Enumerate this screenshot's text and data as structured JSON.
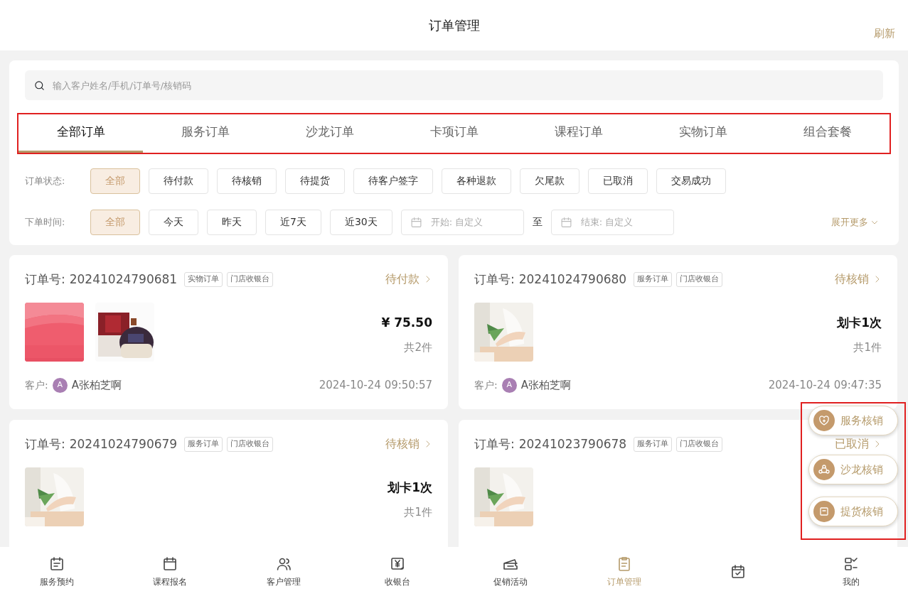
{
  "header": {
    "title": "订单管理",
    "action": "刷新"
  },
  "search": {
    "placeholder": "输入客户姓名/手机/订单号/核销码"
  },
  "tabs_highlighted": true,
  "tabs": [
    {
      "label": "全部订单",
      "selected": true
    },
    {
      "label": "服务订单",
      "selected": false
    },
    {
      "label": "沙龙订单",
      "selected": false
    },
    {
      "label": "卡项订单",
      "selected": false
    },
    {
      "label": "课程订单",
      "selected": false
    },
    {
      "label": "实物订单",
      "selected": false
    },
    {
      "label": "组合套餐",
      "selected": false
    }
  ],
  "status_filter": {
    "label": "订单状态:",
    "options": [
      {
        "label": "全部",
        "selected": true
      },
      {
        "label": "待付款",
        "selected": false
      },
      {
        "label": "待核销",
        "selected": false
      },
      {
        "label": "待提货",
        "selected": false
      },
      {
        "label": "待客户签字",
        "selected": false
      },
      {
        "label": "各种退款",
        "selected": false
      },
      {
        "label": "欠尾款",
        "selected": false
      },
      {
        "label": "已取消",
        "selected": false
      },
      {
        "label": "交易成功",
        "selected": false
      }
    ]
  },
  "time_filter": {
    "label": "下单时间:",
    "options": [
      {
        "label": "全部",
        "selected": true
      },
      {
        "label": "今天",
        "selected": false
      },
      {
        "label": "昨天",
        "selected": false
      },
      {
        "label": "近7天",
        "selected": false
      },
      {
        "label": "近30天",
        "selected": false
      }
    ],
    "start_placeholder": "开始: 自定义",
    "separator": "至",
    "end_placeholder": "结束: 自定义",
    "more": "展开更多"
  },
  "orders": [
    {
      "number_label": "订单号:",
      "number": "20241024790681",
      "tags": [
        "实物订单",
        "门店收银台"
      ],
      "status": "待付款",
      "images": [
        {
          "kind": "picture"
        },
        {
          "kind": "picture"
        }
      ],
      "amount": "¥ 75.50",
      "count": "共2件",
      "customer_label": "客户:",
      "avatar": "A",
      "customer": "A张柏芝啊",
      "time": "2024-10-24 09:50:57"
    },
    {
      "number_label": "订单号:",
      "number": "20241024790680",
      "tags": [
        "服务订单",
        "门店收银台"
      ],
      "status": "待核销",
      "images": [
        {
          "kind": "picture"
        }
      ],
      "amount": "划卡1次",
      "count": "共1件",
      "customer_label": "客户:",
      "avatar": "A",
      "customer": "A张柏芝啊",
      "time": "2024-10-24 09:47:35"
    },
    {
      "number_label": "订单号:",
      "number": "20241024790679",
      "tags": [
        "服务订单",
        "门店收银台"
      ],
      "status": "待核销",
      "images": [
        {
          "kind": "picture"
        }
      ],
      "amount": "划卡1次",
      "count": "共1件"
    },
    {
      "number_label": "订单号:",
      "number": "20241023790678",
      "tags": [
        "服务订单",
        "门店收银台"
      ],
      "status": "已取消",
      "images": [
        {
          "kind": "picture"
        }
      ]
    }
  ],
  "floating_actions_highlighted": true,
  "floating_actions": [
    {
      "label": "服务核销",
      "kind": "heart"
    },
    {
      "label": "沙龙核销",
      "kind": "people"
    },
    {
      "label": "提货核销",
      "kind": "bag"
    }
  ],
  "bottom_nav": [
    {
      "label": "服务预约",
      "kind": "calendar-list",
      "selected": false
    },
    {
      "label": "课程报名",
      "kind": "calendar",
      "selected": false
    },
    {
      "label": "客户管理",
      "kind": "users",
      "selected": false
    },
    {
      "label": "收银台",
      "kind": "cashier",
      "selected": false
    },
    {
      "label": "促销活动",
      "kind": "ticket",
      "selected": false
    },
    {
      "label": "订单管理",
      "kind": "clipboard",
      "selected": true
    },
    {
      "kind": "calendar-check",
      "selected": false
    },
    {
      "label": "我的",
      "kind": "grid-check",
      "selected": false
    }
  ]
}
